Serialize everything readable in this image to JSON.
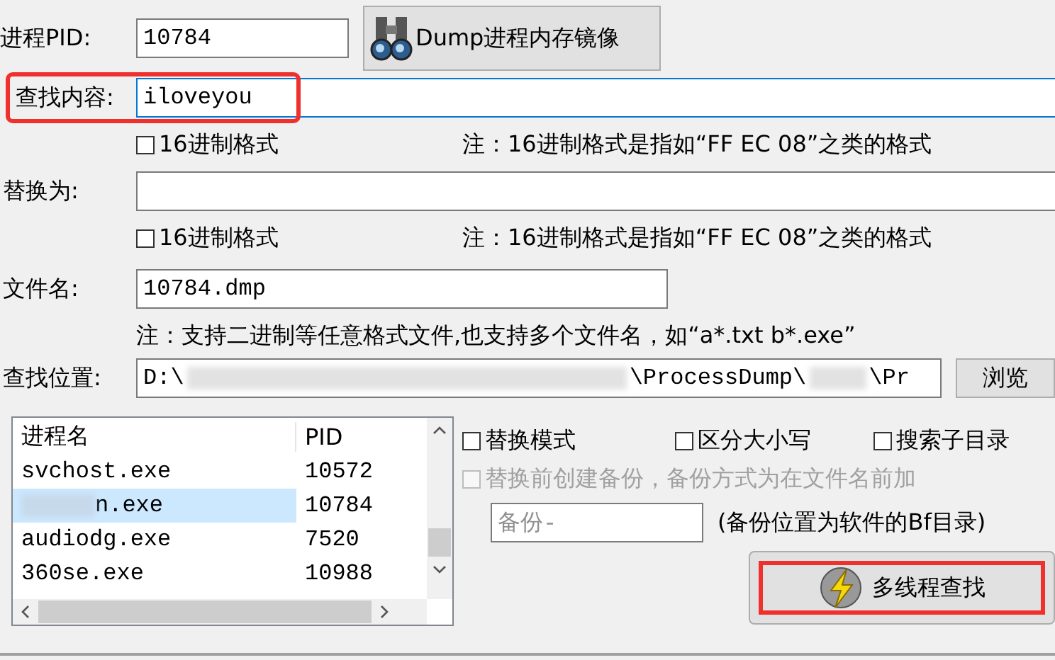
{
  "pid_row": {
    "label": "进程PID:",
    "value": "10784"
  },
  "dump_button": {
    "label": "Dump进程内存镜像"
  },
  "search_row": {
    "label": "查找内容:",
    "value": "iloveyou",
    "highlighted": true
  },
  "search_hex": {
    "label": "16进制格式",
    "checked": false,
    "note": "注：16进制格式是指如“FF EC 08”之类的格式"
  },
  "replace_row": {
    "label": "替换为:"
  },
  "replace_hex": {
    "label": "16进制格式",
    "checked": false,
    "note": "注：16进制格式是指如“FF EC 08”之类的格式"
  },
  "file_row": {
    "label": "文件名:",
    "value": "10784.dmp"
  },
  "file_note": "注：支持二进制等任意格式文件,也支持多个文件名，如“a*.txt b*.exe”",
  "location_row": {
    "label": "查找位置:",
    "path_parts": [
      "D:\\",
      "\\ProcessDump\\",
      "\\Pr"
    ]
  },
  "browse_button": {
    "label": "浏览"
  },
  "process_list": {
    "columns": [
      "进程名",
      "PID"
    ],
    "rows": [
      {
        "name": "svchost.exe",
        "pid": "10572",
        "selected": false,
        "blurred": false
      },
      {
        "name": "n.exe",
        "pid": "10784",
        "selected": true,
        "blurred": true
      },
      {
        "name": "audiodg.exe",
        "pid": "7520",
        "selected": false,
        "blurred": false
      },
      {
        "name": "360se.exe",
        "pid": "10988",
        "selected": false,
        "blurred": false
      }
    ]
  },
  "options": [
    {
      "label": "替换模式",
      "checked": false,
      "disabled": false
    },
    {
      "label": "区分大小写",
      "checked": false,
      "disabled": false
    },
    {
      "label": "搜索子目录",
      "checked": false,
      "disabled": false
    },
    {
      "label": "替换前创建备份，备份方式为在文件名前加",
      "checked": false,
      "disabled": true
    }
  ],
  "backup_prefix": {
    "value": "备份-",
    "disabled": true
  },
  "backup_note": "(备份位置为软件的Bf目录)",
  "search_button": {
    "label": "多线程查找",
    "highlighted": true
  }
}
